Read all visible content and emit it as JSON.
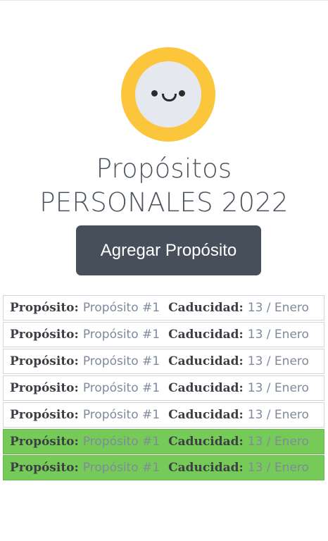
{
  "header": {
    "title_line1": "Propósitos",
    "title_line2": "PERSONALES 2022"
  },
  "logo": {
    "icon": "smiley-face-icon",
    "outer_color": "#fbc63c",
    "inner_color": "#e6e8f0"
  },
  "actions": {
    "add_label": "Agregar Propósito"
  },
  "labels": {
    "purpose": "Propósito:",
    "expiry": "Caducidad:"
  },
  "items": [
    {
      "purpose": "Propósito #1",
      "expiry": "13 / Enero",
      "completed": false
    },
    {
      "purpose": "Propósito #1",
      "expiry": "13 / Enero",
      "completed": false
    },
    {
      "purpose": "Propósito #1",
      "expiry": "13 / Enero",
      "completed": false
    },
    {
      "purpose": "Propósito #1",
      "expiry": "13 / Enero",
      "completed": false
    },
    {
      "purpose": "Propósito #1",
      "expiry": "13 / Enero",
      "completed": false
    },
    {
      "purpose": "Propósito #1",
      "expiry": "13 / Enero",
      "completed": true
    },
    {
      "purpose": "Propósito #1",
      "expiry": "13 / Enero",
      "completed": true
    }
  ],
  "colors": {
    "completed": "#76cb58",
    "button": "#47505a"
  }
}
